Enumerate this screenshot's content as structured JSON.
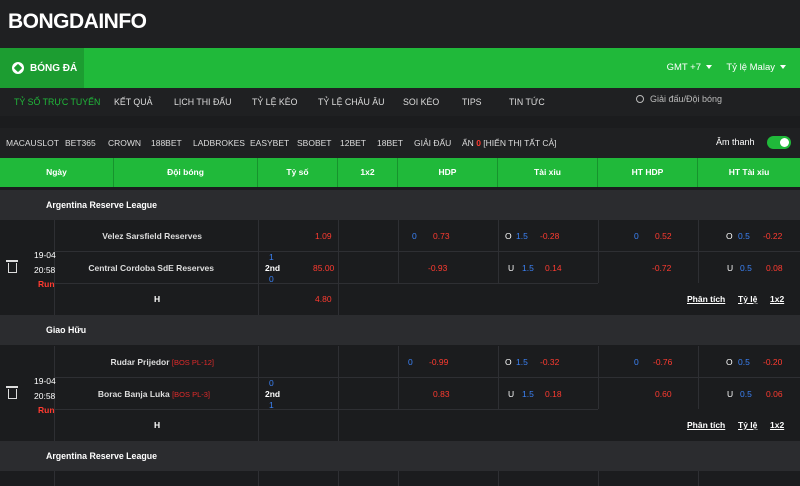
{
  "brand": {
    "logo_text": "BONGDAINFO"
  },
  "main_tab": {
    "label": "BÓNG ĐÁ"
  },
  "header": {
    "gmt": "GMT +7",
    "odds_type": "Tỷ lệ Malay"
  },
  "nav": {
    "items": [
      "TỶ SỐ TRỰC TUYẾN",
      "KẾT QUẢ",
      "LỊCH THI ĐẤU",
      "TỶ LỆ KÈO",
      "TỶ LỆ CHÂU ÂU",
      "SOI KÈO",
      "TIPS",
      "TIN TỨC"
    ],
    "search_placeholder": "Giải đấu/Đội bóng"
  },
  "bookmakers": {
    "items": [
      "MACAUSLOT",
      "BET365",
      "CROWN",
      "188BET",
      "LADBROKES",
      "EASYBET",
      "SBOBET",
      "12BET",
      "18BET",
      "GIẢI ĐẤU"
    ],
    "hidden_label": "ẨN",
    "hidden_count": "0",
    "show_all": "[HIỂN THỊ TẤT CẢ]",
    "sound_label": "Âm thanh",
    "sound_on": true
  },
  "table": {
    "headers": [
      "Ngày",
      "Đội bóng",
      "Tỷ số",
      "1x2",
      "HDP",
      "Tài xỉu",
      "HT HDP",
      "HT Tài xỉu"
    ]
  },
  "colors": {
    "green": "#20b93a",
    "red": "#ff3b30",
    "blue": "#3b82f6"
  },
  "matches": [
    {
      "league": "Argentina Reserve League",
      "date": "19-04",
      "time": "20:58",
      "status": "Run",
      "home": "Velez Sarsfield Reserves",
      "home_tag": "",
      "away": "Central Cordoba SdE Reserves",
      "away_tag": "",
      "draw_label": "H",
      "score_home": "1",
      "period": "2nd",
      "score_away": "0",
      "x12": [
        "1.09",
        "85.00",
        "4.80"
      ],
      "hdp": {
        "line": "0",
        "home": "0.73",
        "away": "-0.93"
      },
      "ou": {
        "o_label": "O",
        "line": "1.5",
        "o_val": "-0.28",
        "u_label": "U",
        "u_line": "1.5",
        "u_val": "0.14"
      },
      "ht_hdp": {
        "line": "0",
        "home": "0.52",
        "away": "-0.72"
      },
      "ht_ou": {
        "o_label": "O",
        "line": "0.5",
        "o_val": "-0.22",
        "u_label": "U",
        "u_line": "0.5",
        "u_val": "0.08"
      },
      "links": [
        "Phân tích",
        "Tỷ lệ",
        "1x2"
      ]
    },
    {
      "league": "Giao Hữu",
      "date": "19-04",
      "time": "20:58",
      "status": "Run",
      "home": "Rudar Prijedor",
      "home_tag": "[BOS PL-12]",
      "away": "Borac Banja Luka",
      "away_tag": "[BOS PL-3]",
      "draw_label": "H",
      "score_home": "0",
      "period": "2nd",
      "score_away": "1",
      "x12": [
        "",
        "",
        ""
      ],
      "hdp": {
        "line": "0",
        "home": "-0.99",
        "away": "0.83"
      },
      "ou": {
        "o_label": "O",
        "line": "1.5",
        "o_val": "-0.32",
        "u_label": "U",
        "u_line": "1.5",
        "u_val": "0.18"
      },
      "ht_hdp": {
        "line": "0",
        "home": "-0.76",
        "away": "0.60"
      },
      "ht_ou": {
        "o_label": "O",
        "line": "0.5",
        "o_val": "-0.20",
        "u_label": "U",
        "u_line": "0.5",
        "u_val": "0.06"
      },
      "links": [
        "Phân tích",
        "Tỷ lệ",
        "1x2"
      ]
    }
  ],
  "league3": "Argentina Reserve League"
}
